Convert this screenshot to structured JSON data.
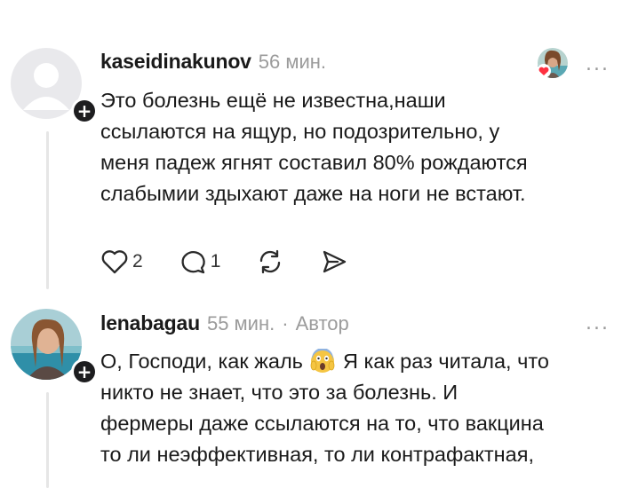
{
  "comments": [
    {
      "username": "kaseidinakunov",
      "time": "56 мин.",
      "author_label": "",
      "text": "Это болезнь ещё не известна,наши\nссылаются на ящур, но подозрительно, у\nменя падеж ягнят составил 80% рождаются\nслабымии здыхают даже на ноги не встают.",
      "likes": "2",
      "replies": "1",
      "menu": "...",
      "plus": "+"
    },
    {
      "username": "lenabagau",
      "time": "55 мин.",
      "separator": "·",
      "author_label": "Автор",
      "text_before_emoji": "О, Господи, как жаль",
      "emoji": "face-screaming-in-fear",
      "text_after_emoji": "Я как раз читала, что\nникто не знает, что это за болезнь. И\nфермеры даже ссылаются на то, что вакцина\nто ли неэффективная, то ли контрафактная,",
      "menu": "...",
      "plus": "+"
    }
  ],
  "colors": {
    "text": "#1a1a1a",
    "muted": "#9b9b9b",
    "heart": "#ff3040",
    "thread_line": "#e6e6e6"
  }
}
